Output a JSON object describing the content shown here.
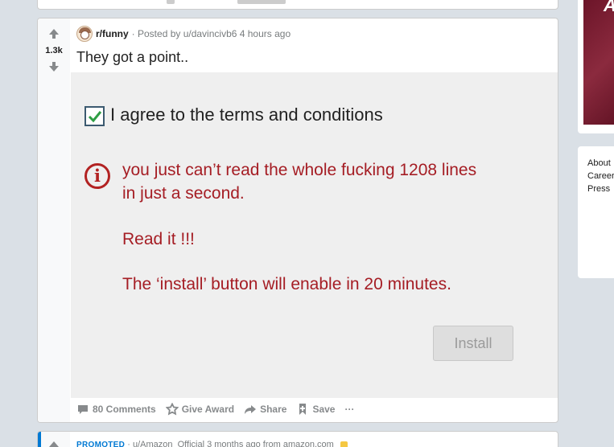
{
  "post": {
    "score": "1.3k",
    "subreddit": "r/funny",
    "posted_by": "· Posted by u/davincivb6 4 hours ago",
    "title": "They got a point..",
    "image": {
      "agree_text": "I agree to the terms and conditions",
      "info_icon": "i",
      "warning_line1": "you just can’t read the whole fucking 1208 lines",
      "warning_line2": "in just a second.",
      "warning_line3": "Read it !!!",
      "warning_line4": "The ‘install’ button will enable in 20 minutes.",
      "install_label": "Install"
    },
    "actions": {
      "comments": "80 Comments",
      "award": "Give Award",
      "share": "Share",
      "save": "Save",
      "more": "···"
    }
  },
  "sidebar": {
    "card_letter": "A",
    "links": [
      "About",
      "Careers",
      "Press"
    ]
  },
  "next_post": {
    "promoted": "PROMOTED",
    "meta": "· u/Amazon_Official 3 months ago from amazon.com"
  },
  "colors": {
    "accent": "#0079d3",
    "warning_red": "#a51d24",
    "background": "#dae0e6"
  }
}
